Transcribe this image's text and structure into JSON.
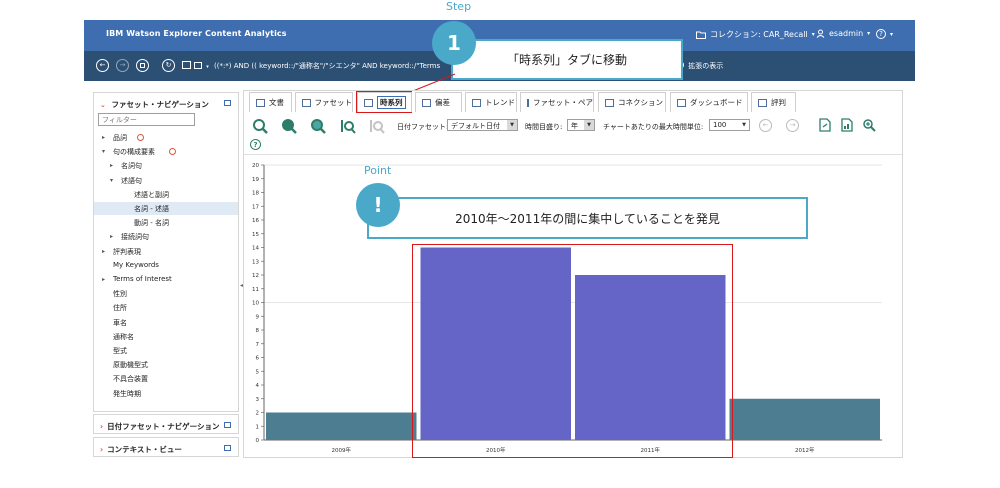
{
  "header": {
    "app_title": "IBM Watson Explorer Content Analytics",
    "collection": "コレクション: CAR_Recall",
    "user": "esadmin",
    "help": "?"
  },
  "query_bar": {
    "query_text": "((*:*) AND (( keyword::/\"通称名\"/\"シエンタ\" AND keyword::/\"Terms",
    "extended_label": "拡張の表示"
  },
  "callouts": {
    "step_label": "Step",
    "step_number": "1",
    "step_text": "「時系列」タブに移動",
    "point_label": "Point",
    "point_mark": "!",
    "point_text": "2010年～2011年の間に集中していることを発見"
  },
  "left_panel": {
    "title": "ファセット・ナビゲーション",
    "filter_placeholder": "フィルター",
    "items": [
      {
        "label": "品詞",
        "level": 0,
        "tri": "▸",
        "badge": true
      },
      {
        "label": "句の構成要素",
        "level": 0,
        "tri": "▾",
        "badge": true
      },
      {
        "label": "名詞句",
        "level": 1,
        "tri": "▸",
        "badge": false
      },
      {
        "label": "述語句",
        "level": 1,
        "tri": "▾",
        "badge": false
      },
      {
        "label": "述語と副詞",
        "level": 2,
        "tri": "",
        "badge": false
      },
      {
        "label": "名詞 - 述語",
        "level": 2,
        "tri": "",
        "badge": false,
        "selected": true
      },
      {
        "label": "動詞 - 名詞",
        "level": 2,
        "tri": "",
        "badge": false
      },
      {
        "label": "接続詞句",
        "level": 1,
        "tri": "▸",
        "badge": false
      },
      {
        "label": "評判表現",
        "level": 0,
        "tri": "▸",
        "badge": false
      },
      {
        "label": "My Keywords",
        "level": 0,
        "tri": "",
        "badge": false
      },
      {
        "label": "Terms of Interest",
        "level": 0,
        "tri": "▸",
        "badge": false
      },
      {
        "label": "性別",
        "level": 0,
        "tri": "",
        "badge": false
      },
      {
        "label": "住所",
        "level": 0,
        "tri": "",
        "badge": false
      },
      {
        "label": "車名",
        "level": 0,
        "tri": "",
        "badge": false
      },
      {
        "label": "通称名",
        "level": 0,
        "tri": "",
        "badge": false
      },
      {
        "label": "型式",
        "level": 0,
        "tri": "",
        "badge": false
      },
      {
        "label": "原動機型式",
        "level": 0,
        "tri": "",
        "badge": false
      },
      {
        "label": "不具合装置",
        "level": 0,
        "tri": "",
        "badge": false
      },
      {
        "label": "発生時期",
        "level": 0,
        "tri": "",
        "badge": false
      }
    ],
    "date_facet_title": "日付ファセット・ナビゲーション",
    "context_view_title": "コンテキスト・ビュー"
  },
  "tabs": [
    {
      "label": "文書",
      "active": false
    },
    {
      "label": "ファセット",
      "active": false
    },
    {
      "label": "時系列",
      "active": true
    },
    {
      "label": "偏差",
      "active": false
    },
    {
      "label": "トレンド",
      "active": false
    },
    {
      "label": "ファセット・ペア",
      "active": false
    },
    {
      "label": "コネクション",
      "active": false
    },
    {
      "label": "ダッシュボード",
      "active": false
    },
    {
      "label": "評判",
      "active": false
    }
  ],
  "toolbar": {
    "date_facet_label": "日付ファセット:",
    "date_facet_value": "デフォルト日付",
    "time_scale_label": "時間目盛り:",
    "time_scale_value": "年",
    "max_units_label": "チャートあたりの最大時間単位:",
    "max_units_value": "100"
  },
  "chart_data": {
    "type": "bar",
    "categories": [
      "2009年",
      "2010年",
      "2011年",
      "2012年"
    ],
    "values": [
      2,
      14,
      12,
      3
    ],
    "ylim": [
      0,
      20
    ],
    "yticks": [
      0,
      1,
      2,
      3,
      4,
      5,
      6,
      7,
      8,
      9,
      10,
      11,
      12,
      13,
      14,
      15,
      16,
      17,
      18,
      19,
      20
    ],
    "grid": "y at 10 and 20",
    "colors": {
      "normal": "#4d7d91",
      "highlight": "#6565c8"
    },
    "highlighted": [
      "2010年",
      "2011年"
    ]
  }
}
